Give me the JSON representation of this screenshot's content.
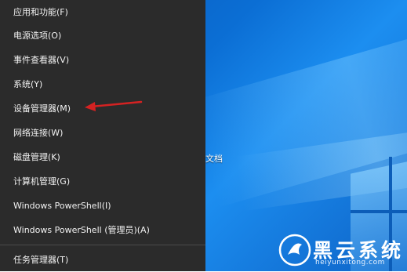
{
  "menu": {
    "items": [
      {
        "label": "应用和功能(F)"
      },
      {
        "label": "电源选项(O)"
      },
      {
        "label": "事件查看器(V)"
      },
      {
        "label": "系统(Y)"
      },
      {
        "label": "设备管理器(M)"
      },
      {
        "label": "网络连接(W)"
      },
      {
        "label": "磁盘管理(K)"
      },
      {
        "label": "计算机管理(G)"
      },
      {
        "label": "Windows PowerShell(I)"
      },
      {
        "label": "Windows PowerShell (管理员)(A)"
      },
      {
        "label": "任务管理器(T)"
      }
    ]
  },
  "desktop": {
    "doc_fragment": "文档"
  },
  "annotation": {
    "arrow_color": "#d42222",
    "points_to": "设备管理器(M)"
  },
  "watermark": {
    "title": "黑云系统",
    "url": "heiyunxitong.com"
  },
  "colors": {
    "menu_bg": "#2b2b2b",
    "menu_text": "#f2f2f2",
    "desktop_blue": "#0b6ed4"
  }
}
